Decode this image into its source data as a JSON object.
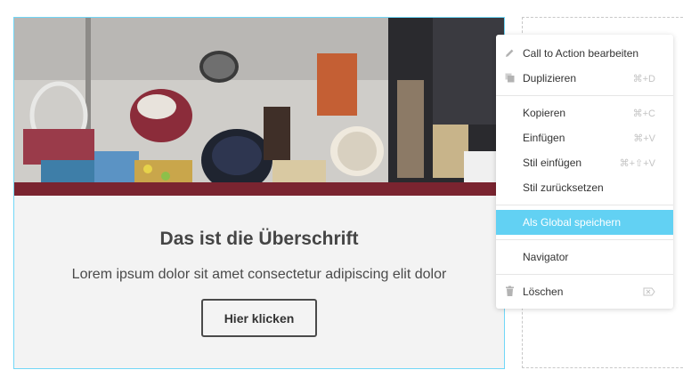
{
  "cta": {
    "headline": "Das ist die Überschrift",
    "description": "Lorem ipsum dolor sit amet consectetur adipiscing elit dolor",
    "button_label": "Hier klicken"
  },
  "context_menu": {
    "items": [
      {
        "label": "Call to Action bearbeiten",
        "shortcut": "",
        "icon": "pencil-icon"
      },
      {
        "label": "Duplizieren",
        "shortcut": "⌘+D",
        "icon": "duplicate-icon"
      },
      {
        "label": "Kopieren",
        "shortcut": "⌘+C"
      },
      {
        "label": "Einfügen",
        "shortcut": "⌘+V"
      },
      {
        "label": "Stil einfügen",
        "shortcut": "⌘+⇧+V"
      },
      {
        "label": "Stil zurücksetzen",
        "shortcut": ""
      },
      {
        "label": "Als Global speichern",
        "shortcut": "",
        "active": true
      },
      {
        "label": "Navigator",
        "shortcut": ""
      },
      {
        "label": "Löschen",
        "shortcut": "",
        "icon": "trash-icon",
        "shortcut_icon": "delete-key-icon"
      }
    ]
  },
  "colors": {
    "accent": "#62d1f3",
    "widget_border": "#71d7f7",
    "widget_background": "#f3f3f3"
  }
}
